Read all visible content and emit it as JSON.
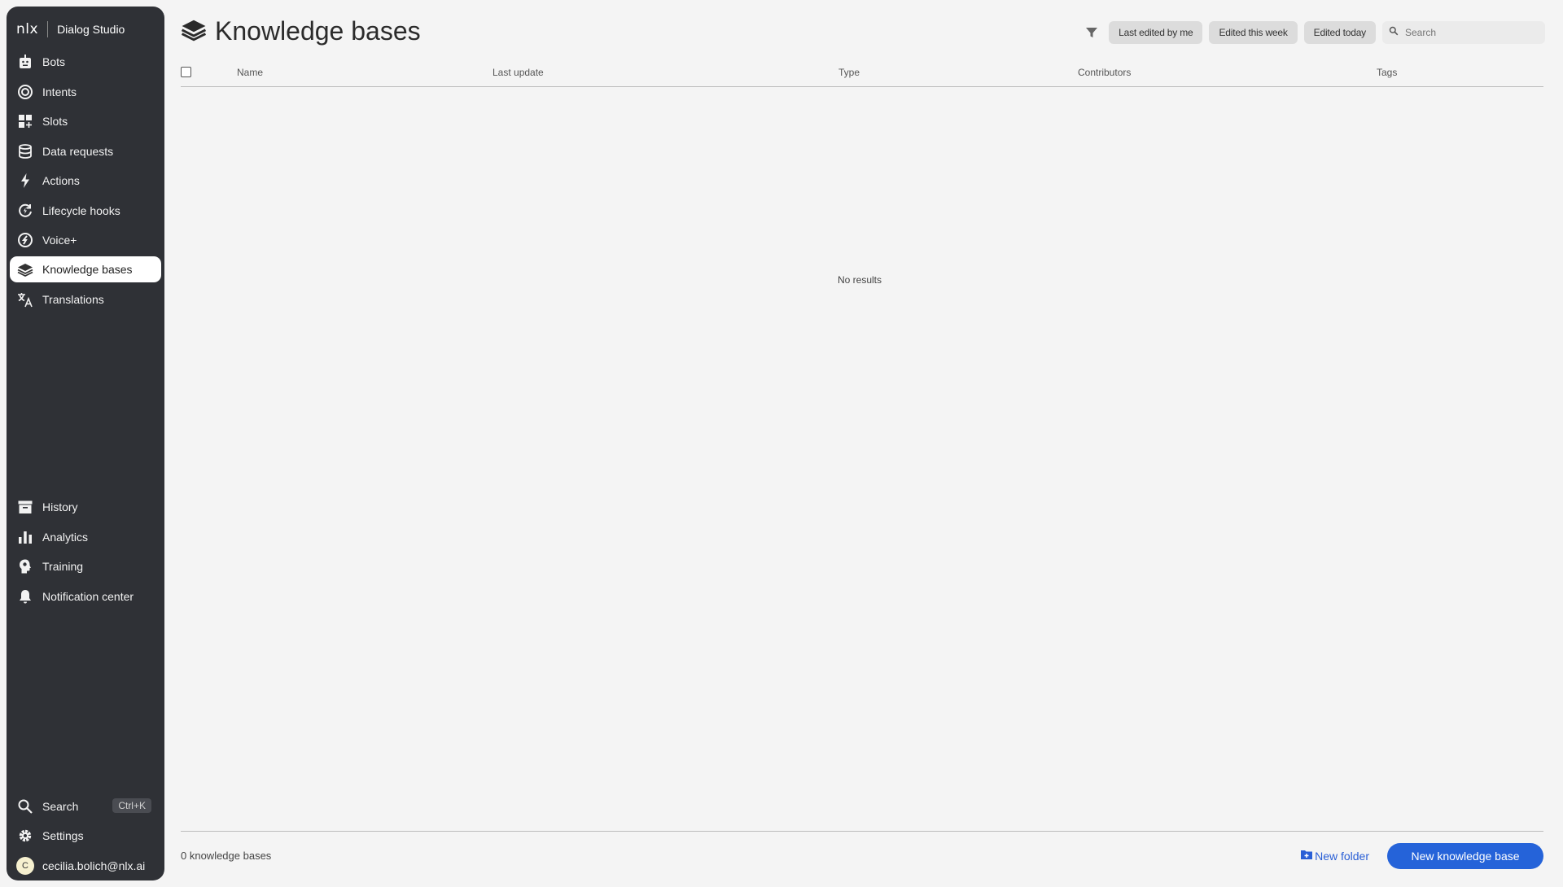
{
  "brand": {
    "logo": "nlx",
    "app_name": "Dialog Studio"
  },
  "sidebar": {
    "top_items": [
      {
        "label": "Bots",
        "icon": "bot-icon"
      },
      {
        "label": "Intents",
        "icon": "target-icon"
      },
      {
        "label": "Slots",
        "icon": "grid-plus-icon"
      },
      {
        "label": "Data requests",
        "icon": "database-icon"
      },
      {
        "label": "Actions",
        "icon": "bolt-icon"
      },
      {
        "label": "Lifecycle hooks",
        "icon": "cycle-bolt-icon"
      },
      {
        "label": "Voice+",
        "icon": "voice-plus-icon"
      },
      {
        "label": "Knowledge bases",
        "icon": "layers-icon",
        "active": true
      },
      {
        "label": "Translations",
        "icon": "translate-icon"
      }
    ],
    "bottom_items": [
      {
        "label": "History",
        "icon": "archive-icon"
      },
      {
        "label": "Analytics",
        "icon": "bar-chart-icon"
      },
      {
        "label": "Training",
        "icon": "brain-icon"
      },
      {
        "label": "Notification center",
        "icon": "bell-icon"
      }
    ],
    "search": {
      "label": "Search",
      "shortcut": "Ctrl+K"
    },
    "settings": {
      "label": "Settings"
    },
    "user": {
      "initial": "C",
      "email": "cecilia.bolich@nlx.ai"
    }
  },
  "page": {
    "title": "Knowledge bases"
  },
  "filters": {
    "chips": [
      "Last edited by me",
      "Edited this week",
      "Edited today"
    ],
    "search_placeholder": "Search"
  },
  "table": {
    "columns": [
      "Name",
      "Last update",
      "Type",
      "Contributors",
      "Tags"
    ],
    "rows": [],
    "empty_text": "No results"
  },
  "footer": {
    "count_text": "0 knowledge bases",
    "new_folder_label": "New folder",
    "new_kb_label": "New knowledge base"
  },
  "colors": {
    "sidebar_bg": "#2f3136",
    "accent": "#2563d9",
    "page_bg": "#f4f4f4"
  }
}
